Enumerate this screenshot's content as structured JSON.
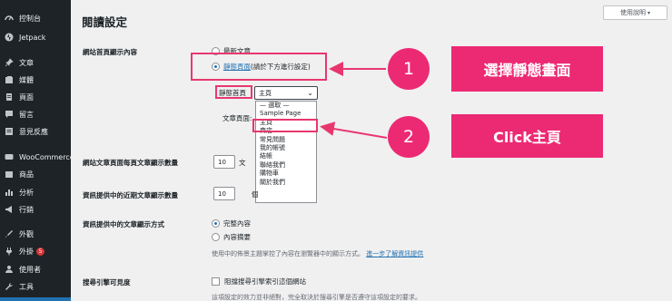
{
  "sidebar": {
    "items": [
      {
        "label": "控制台",
        "icon": "dashboard-icon"
      },
      {
        "label": "Jetpack",
        "icon": "jetpack-icon"
      },
      {
        "label": "文章",
        "icon": "pin-icon"
      },
      {
        "label": "媒體",
        "icon": "media-icon"
      },
      {
        "label": "頁面",
        "icon": "page-icon"
      },
      {
        "label": "留言",
        "icon": "comment-icon"
      },
      {
        "label": "意見反應",
        "icon": "feedback-icon"
      },
      {
        "label": "WooCommerce",
        "icon": "woocommerce-icon"
      },
      {
        "label": "商品",
        "icon": "product-icon"
      },
      {
        "label": "分析",
        "icon": "analytics-icon"
      },
      {
        "label": "行銷",
        "icon": "marketing-icon"
      },
      {
        "label": "外觀",
        "icon": "appearance-icon"
      },
      {
        "label": "外掛",
        "icon": "plugin-icon",
        "badge": "5"
      },
      {
        "label": "使用者",
        "icon": "users-icon"
      },
      {
        "label": "工具",
        "icon": "tools-icon"
      }
    ]
  },
  "header": {
    "title": "閱讀設定",
    "help": "使用說明"
  },
  "homepage": {
    "label": "網站首頁顯示內容",
    "latest_posts": "最新文章",
    "static_page_link": "靜態頁面",
    "static_page_note": " (請於下方進行設定)",
    "homepage_label": "靜態首頁",
    "homepage_selected": "主頁",
    "posts_page_label": "文章頁面:",
    "dropdown_options": [
      "— 選取 —",
      "Sample Page",
      "主頁",
      "商店",
      "常見問題",
      "我的帳號",
      "結帳",
      "聯絡我們",
      "購物車",
      "關於我們"
    ]
  },
  "blog_pages": {
    "label": "網站文章頁面每頁文章顯示數量",
    "value": "10",
    "suffix": "文"
  },
  "syndication": {
    "label": "資訊提供中的近期文章顯示數量",
    "value": "10",
    "suffix": "個"
  },
  "feed_content": {
    "label": "資訊提供中的文章顯示方式",
    "full_text": "完整內容",
    "summary": "內容摘要",
    "desc": "使用中的佈景主題掌控了內容在瀏覽器中的顯示方式。",
    "desc_link": "進一步了解資訊提供"
  },
  "search_visibility": {
    "label": "搜尋引擎可見度",
    "checkbox_label": "阻擋搜尋引擎索引這個網站",
    "desc": "這項設定的效力並非絕對，完全取決於搜尋引擎是否遵守這項設定的要求。"
  },
  "callouts": {
    "step1": "1",
    "step1_text": "選擇靜態畫面",
    "step2": "2",
    "step2_text": "Click主頁"
  },
  "colors": {
    "accent": "#ec2a73",
    "wp_blue": "#2271b1",
    "sidebar_bg": "#1d2327"
  }
}
